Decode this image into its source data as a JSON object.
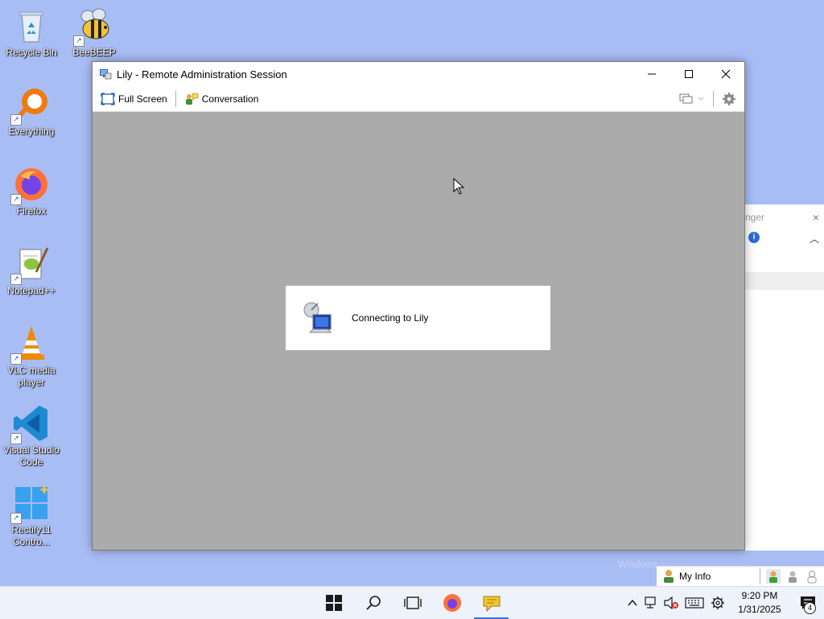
{
  "desktop": {
    "icons": [
      {
        "label": "Recycle Bin",
        "icon": "recycle-bin-icon"
      },
      {
        "label": "BeeBEEP",
        "icon": "beebeep-icon"
      },
      {
        "label": "Everything",
        "icon": "everything-icon"
      },
      {
        "label": "Firefox",
        "icon": "firefox-icon"
      },
      {
        "label": "Notepad++",
        "icon": "notepadpp-icon"
      },
      {
        "label": "VLC media player",
        "icon": "vlc-icon"
      },
      {
        "label": "Visual Studio Code",
        "icon": "vscode-icon"
      },
      {
        "label": "Rectify11 Contro...",
        "icon": "rectify11-icon"
      }
    ],
    "watermark": "Windows"
  },
  "background_window": {
    "title_fragment": "nger",
    "close_glyph": "×"
  },
  "ra_window": {
    "title": "Lily - Remote Administration Session",
    "toolbar": {
      "full_screen": "Full Screen",
      "conversation": "Conversation"
    },
    "status": "Connecting to Lily"
  },
  "myinfo": {
    "label": "My Info"
  },
  "taskbar": {
    "time": "9:20 PM",
    "date": "1/31/2025",
    "notification_count": "4"
  },
  "colors": {
    "desktop": "#a9bdf5",
    "session_area": "#ababab",
    "taskbar": "#eef3fb",
    "accent": "#3b6fd8"
  }
}
